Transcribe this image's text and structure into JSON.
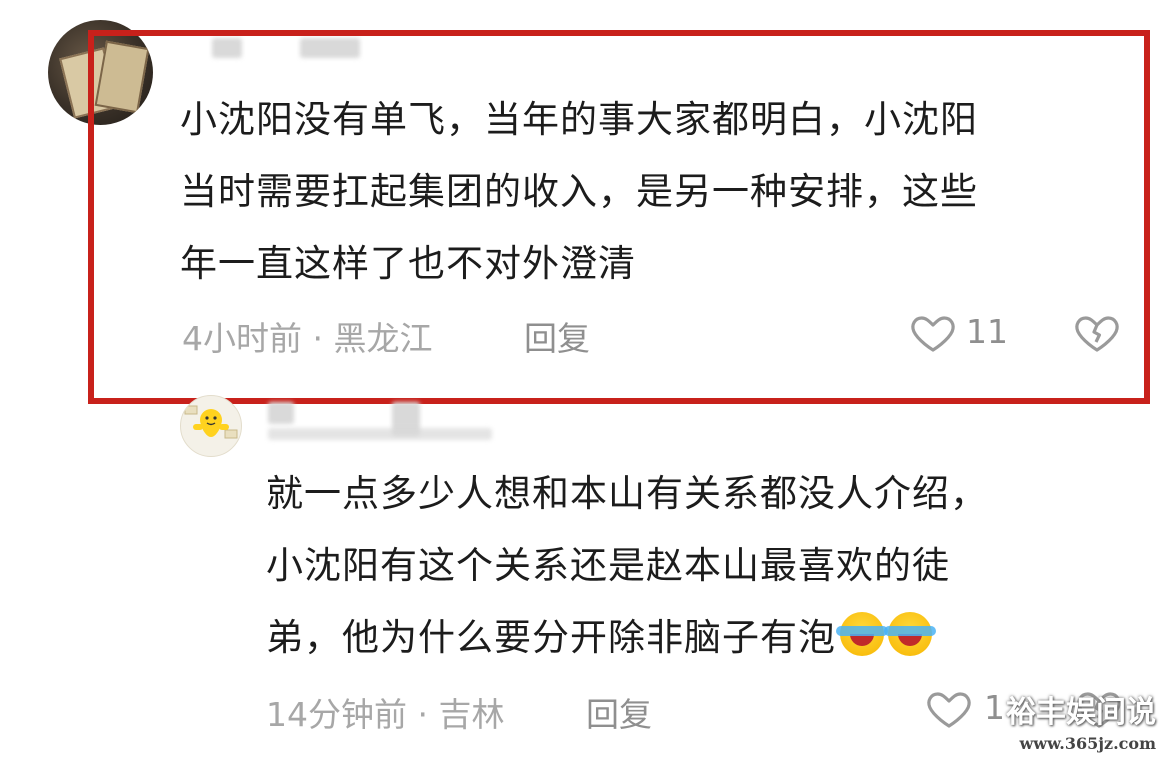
{
  "comments": [
    {
      "text": "小沈阳没有单飞，当年的事大家都明白，小沈阳当时需要扛起集团的收入，是另一种安排，这些年一直这样了也不对外澄清",
      "lines": [
        "小沈阳没有单飞，当年的事大家都明白，小沈阳",
        "当时需要扛起集团的收入，是另一种安排，这些",
        "年一直这样了也不对外澄清"
      ],
      "meta": "4小时前 · 黑龙江",
      "reply_label": "回复",
      "like_count": "11"
    },
    {
      "lines": [
        "就一点多少人想和本山有关系都没人介绍，",
        "小沈阳有这个关系还是赵本山最喜欢的徒",
        "弟，他为什么要分开除非脑子有泡"
      ],
      "emojis": [
        "laughing-crying-emoji",
        "laughing-crying-emoji"
      ],
      "meta": "14分钟前 · 吉林",
      "reply_label": "回复",
      "like_count": "1"
    }
  ],
  "watermark": {
    "text": "裕丰娱间说",
    "url": "www.365jz.com"
  },
  "colors": {
    "highlight_border": "#c8211b",
    "text": "#1c1c1c",
    "meta": "#a7a7a7"
  }
}
